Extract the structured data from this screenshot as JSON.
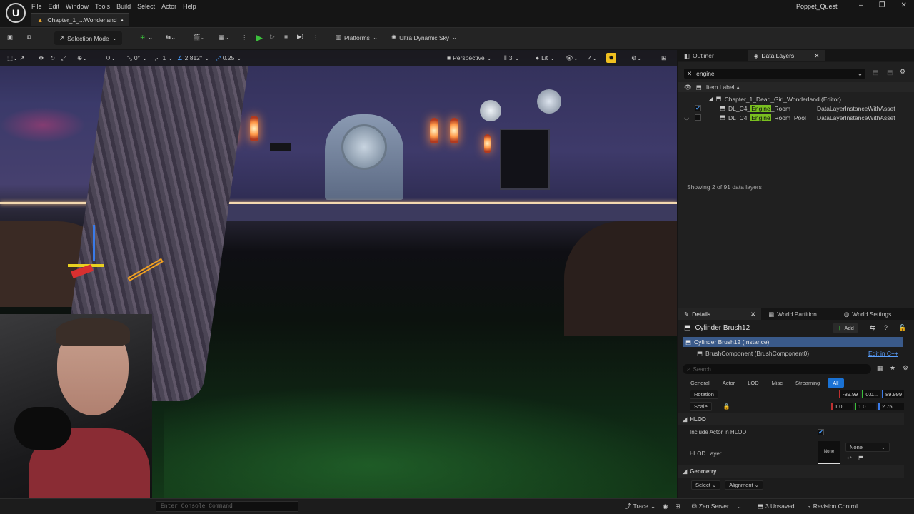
{
  "menu": [
    "File",
    "Edit",
    "Window",
    "Tools",
    "Build",
    "Select",
    "Actor",
    "Help"
  ],
  "doc_tab": "Chapter_1_...Wonderland",
  "doc_tab_dirty": "•",
  "project_name": "Poppet_Quest",
  "window_buttons": [
    "–",
    "❐",
    "✕"
  ],
  "toolbar": {
    "selection_mode": "Selection Mode",
    "platforms": "Platforms",
    "sky": "Ultra Dynamic Sky"
  },
  "viewport": {
    "rot_snap": "0°",
    "grid": "1",
    "angle": "2.812°",
    "scale": "0.25",
    "perspective": "Perspective",
    "cam_speed": "3",
    "lit": "Lit"
  },
  "outliner": {
    "tab_outliner": "Outliner",
    "tab_datalayers": "Data Layers",
    "filter": "engine",
    "column": "Item Label",
    "root": "Chapter_1_Dead_Girl_Wonderland (Editor)",
    "rows": [
      {
        "pre": "DL_C4_",
        "hl": "Engine",
        "post": "_Room",
        "type": "DataLayerInstanceWithAsset",
        "checked": "✔"
      },
      {
        "pre": "DL_C4_",
        "hl": "Engine",
        "post": "_Room_Pool",
        "type": "DataLayerInstanceWithAsset",
        "checked": ""
      }
    ],
    "showing": "Showing 2 of 91 data layers"
  },
  "details": {
    "tab_details": "Details",
    "tab_world_partition": "World Partition",
    "tab_world_settings": "World Settings",
    "actor_name": "Cylinder Brush12",
    "add": "Add",
    "instance": "Cylinder Brush12 (Instance)",
    "component": "BrushComponent (BrushComponent0)",
    "edit_cpp": "Edit in C++",
    "search_placeholder": "Search",
    "categories": [
      "General",
      "Actor",
      "LOD",
      "Misc",
      "Streaming",
      "All"
    ],
    "rotation_label": "Rotation",
    "rotation": [
      "-89.99",
      "0.0...",
      "89.999"
    ],
    "scale_label": "Scale",
    "scale": [
      "1.0",
      "1.0",
      "2.75"
    ],
    "hlod_header": "HLOD",
    "include_hlod": "Include Actor in HLOD",
    "hlod_layer": "HLOD Layer",
    "hlod_thumb": "None",
    "hlod_none": "None",
    "geometry_header": "Geometry",
    "select": "Select",
    "alignment": "Alignment"
  },
  "status": {
    "console_placeholder": "Enter Console Command",
    "trace": "Trace",
    "zen": "Zen Server",
    "unsaved": "3 Unsaved",
    "revision": "Revision Control"
  },
  "colors": {
    "accent": "#1a72d4",
    "highlight": "#7ac020",
    "play": "#3bbf3b"
  }
}
